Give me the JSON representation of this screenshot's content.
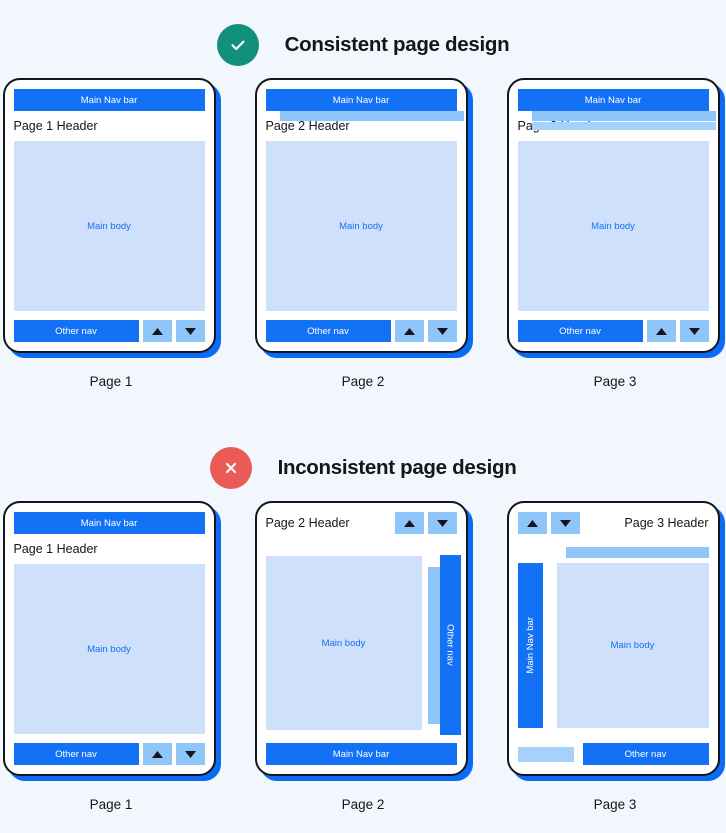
{
  "sections": [
    {
      "id": "consistent",
      "badge": "check-icon",
      "badge_color": "#138f7e",
      "title": "Consistent page design",
      "phones": [
        {
          "caption": "Page 1",
          "layout": "standard",
          "nav_top": "Main Nav bar",
          "header": "Page 1 Header",
          "body": "Main body",
          "other_nav": "Other nav",
          "overlays": 0
        },
        {
          "caption": "Page 2",
          "layout": "standard",
          "nav_top": "Main Nav bar",
          "header": "Page 2 Header",
          "body": "Main body",
          "other_nav": "Other nav",
          "overlays": 1
        },
        {
          "caption": "Page 3",
          "layout": "standard",
          "nav_top": "Main Nav bar",
          "header": "Page 3 Header",
          "body": "Main body",
          "other_nav": "Other nav",
          "overlays": 2
        }
      ]
    },
    {
      "id": "inconsistent",
      "badge": "cross-icon",
      "badge_color": "#ea5a57",
      "title": "Inconsistent page design",
      "phones": [
        {
          "caption": "Page 1",
          "layout": "standard",
          "nav_top": "Main Nav bar",
          "header": "Page 1 Header",
          "body": "Main body",
          "other_nav": "Other nav",
          "overlays": 0
        },
        {
          "caption": "Page 2",
          "layout": "side-nav-right",
          "nav_bottom": "Main Nav bar",
          "header": "Page 2 Header",
          "body": "Main body",
          "other_nav": "Other nav"
        },
        {
          "caption": "Page 3",
          "layout": "side-nav-left",
          "nav_side": "Main Nav bar",
          "header": "Page 3 Header",
          "body": "Main body",
          "other_nav": "Other nav"
        }
      ]
    }
  ],
  "colors": {
    "background": "#f2f6fd",
    "primary_blue": "#1271f5",
    "shadow_blue": "#0a6bf5",
    "light_blue": "#8fc6fa",
    "lighter_blue": "#a4d2fb",
    "body_blue": "#cfe0fa",
    "outline": "#15161c",
    "check_green": "#138f7e",
    "cross_red": "#ea5a57"
  },
  "arrows": {
    "up": "arrow-up-icon",
    "down": "arrow-down-icon"
  }
}
